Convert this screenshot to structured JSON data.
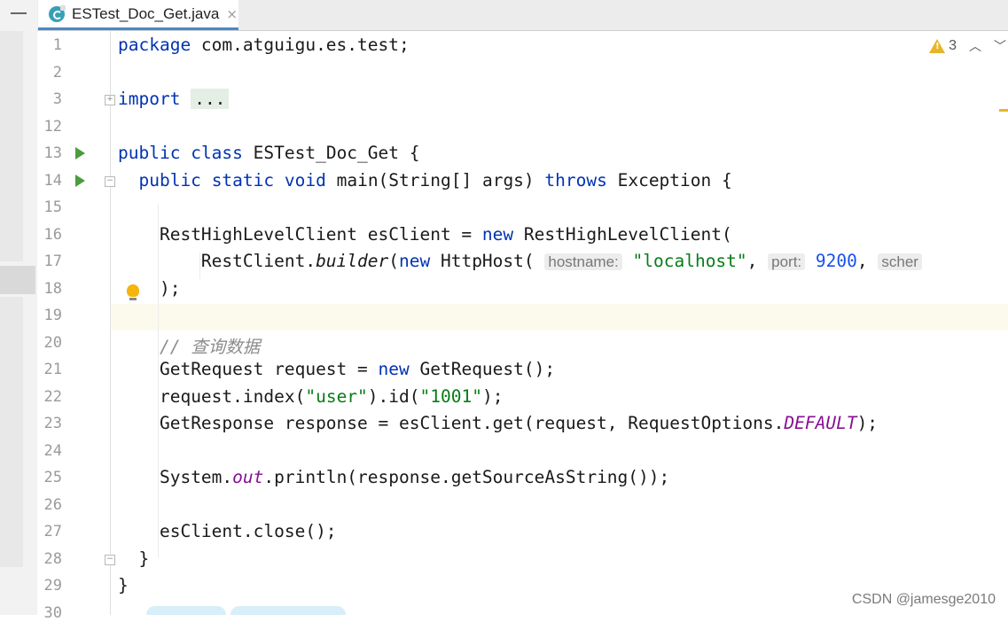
{
  "tab": {
    "filename": "ESTest_Doc_Get.java",
    "close": "×"
  },
  "inspections": {
    "warning_count": "3",
    "up": "︿",
    "down": "﹀"
  },
  "line_numbers": [
    "1",
    "2",
    "3",
    "12",
    "13",
    "14",
    "15",
    "16",
    "17",
    "18",
    "19",
    "20",
    "21",
    "22",
    "23",
    "24",
    "25",
    "26",
    "27",
    "28",
    "29",
    "30"
  ],
  "hints": {
    "hostname": "hostname:",
    "port": "port:",
    "scheme": "scher"
  },
  "code": {
    "l1_kw": "package",
    "l1_rest": " com.atguigu.es.test;",
    "l3_kw": "import",
    "l3_fold": "...",
    "l13_kw1": "public",
    "l13_kw2": "class",
    "l13_rest": " ESTest_Doc_Get {",
    "l14_kw1": "public",
    "l14_kw2": "static",
    "l14_kw3": "void",
    "l14_mid": " main(String[] args) ",
    "l14_kw4": "throws",
    "l14_rest": " Exception {",
    "l16_a": "RestHighLevelClient esClient = ",
    "l16_kw": "new",
    "l16_b": " RestHighLevelClient(",
    "l17_a": "RestClient.",
    "l17_it": "builder",
    "l17_b": "(",
    "l17_kw": "new",
    "l17_c": " HttpHost( ",
    "l17_str": "\"localhost\"",
    "l17_comma": ", ",
    "l17_num": "9200",
    "l17_comma2": ", ",
    "l18": ");",
    "l20_cmt": "// 查询数据",
    "l21_a": "GetRequest request = ",
    "l21_kw": "new",
    "l21_b": " GetRequest();",
    "l22_a": "request.index(",
    "l22_s1": "\"user\"",
    "l22_b": ").id(",
    "l22_s2": "\"1001\"",
    "l22_c": ");",
    "l23_a": "GetResponse response = esClient.get(request, RequestOptions.",
    "l23_stat": "DEFAULT",
    "l23_b": ");",
    "l25_a": "System.",
    "l25_stat": "out",
    "l25_b": ".println(response.getSourceAsString());",
    "l27": "esClient.close();",
    "l28": "}",
    "l29": "}"
  },
  "watermark": "CSDN @jamesge2010"
}
